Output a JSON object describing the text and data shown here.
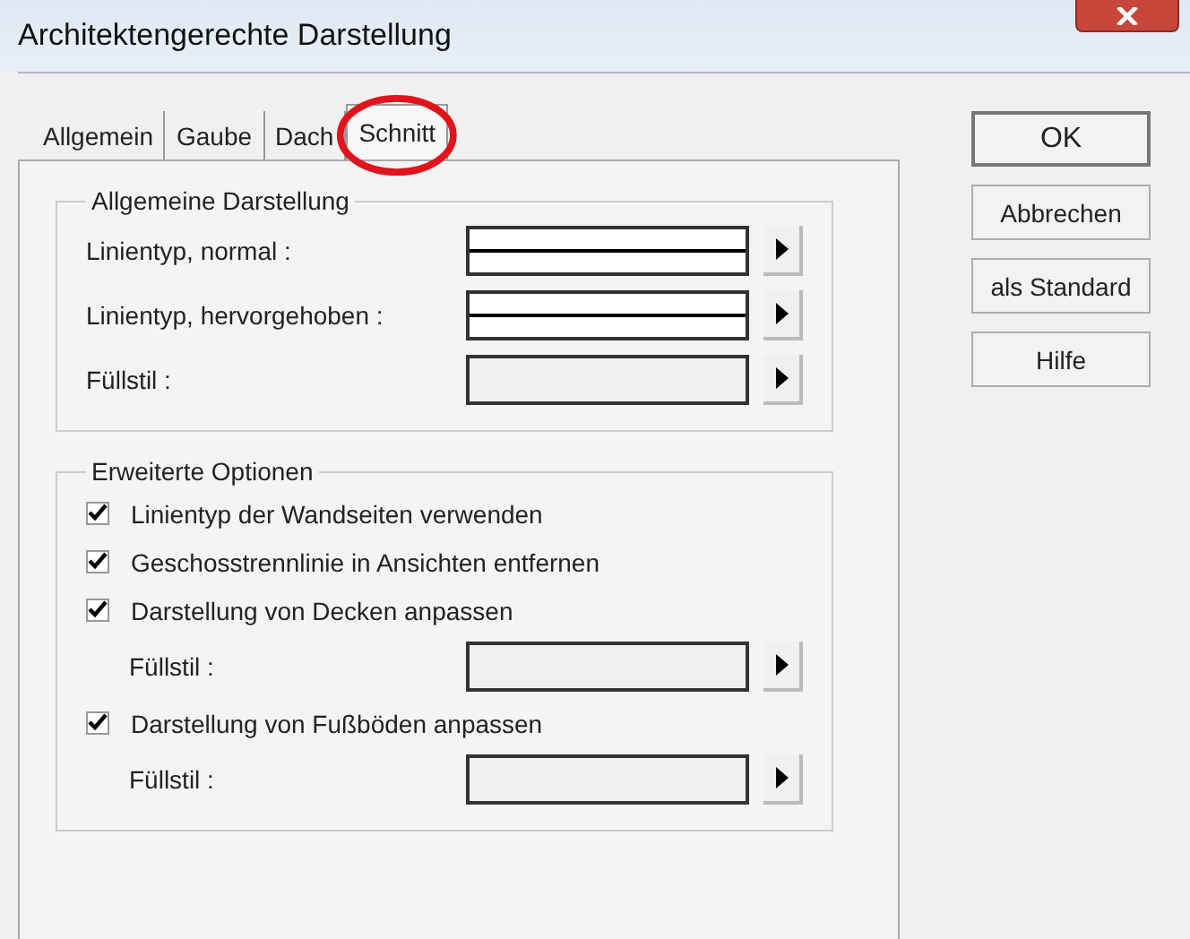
{
  "window": {
    "title": "Architektengerechte Darstellung"
  },
  "tabs": [
    {
      "label": "Allgemein",
      "selected": false
    },
    {
      "label": "Gaube",
      "selected": false
    },
    {
      "label": "Dach",
      "selected": false
    },
    {
      "label": "Schnitt",
      "selected": true
    }
  ],
  "groups": [
    {
      "title": "Allgemeine Darstellung",
      "rows": [
        {
          "kind": "line",
          "label": "Linientyp, normal :"
        },
        {
          "kind": "line",
          "label": "Linientyp, hervorgehoben :"
        },
        {
          "kind": "fill",
          "label": "Füllstil :"
        }
      ]
    },
    {
      "title": "Erweiterte Optionen",
      "rows": [
        {
          "kind": "checkbox",
          "label": "Linientyp der Wandseiten verwenden",
          "checked": true
        },
        {
          "kind": "checkbox",
          "label": "Geschosstrennlinie in Ansichten entfernen",
          "checked": true
        },
        {
          "kind": "checkbox",
          "label": "Darstellung von Decken anpassen",
          "checked": true
        },
        {
          "kind": "fill",
          "label": "Füllstil :",
          "indent": true
        },
        {
          "kind": "checkbox",
          "label": "Darstellung von Fußböden anpassen",
          "checked": true
        },
        {
          "kind": "fill",
          "label": "Füllstil :",
          "indent": true
        }
      ]
    }
  ],
  "buttons": [
    {
      "label": "OK",
      "default": true
    },
    {
      "label": "Abbrechen",
      "default": false
    },
    {
      "label": "als Standard",
      "default": false
    },
    {
      "label": "Hilfe",
      "default": false
    }
  ]
}
